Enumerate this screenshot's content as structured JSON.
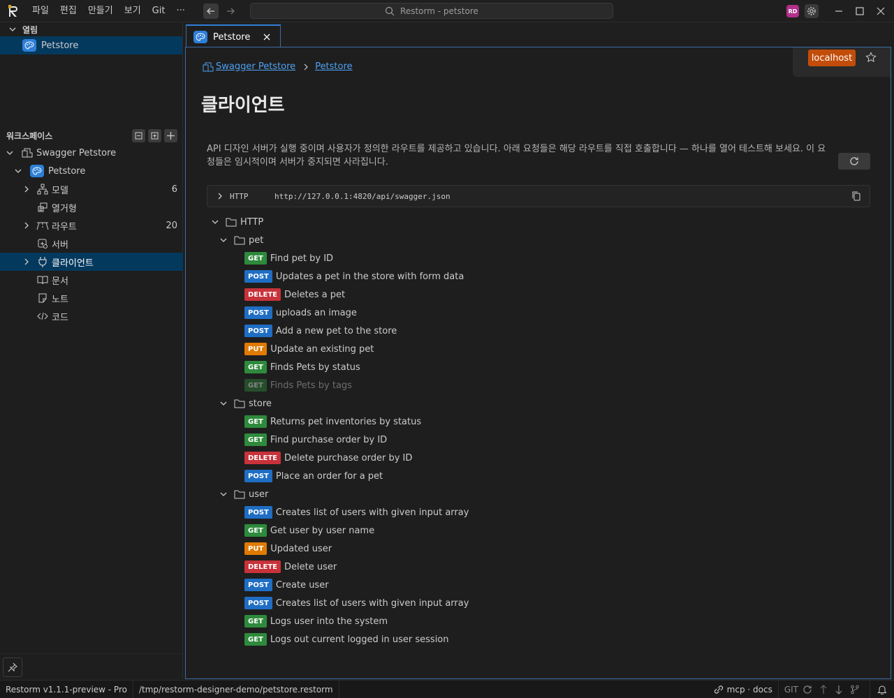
{
  "titlebar": {
    "menus": [
      "파일",
      "편집",
      "만들기",
      "보기",
      "Git",
      "···"
    ],
    "search_text": "Restorm - petstore",
    "avatar_initials": "RD"
  },
  "sidebar": {
    "open_section": "열림",
    "open_item": "Petstore",
    "workspace_section": "워크스페이스",
    "tree": {
      "root": "Swagger Petstore",
      "project": "Petstore",
      "items": [
        {
          "label": "모델",
          "count": "6"
        },
        {
          "label": "열거형",
          "count": ""
        },
        {
          "label": "라우트",
          "count": "20"
        },
        {
          "label": "서버",
          "count": ""
        },
        {
          "label": "클라이언트",
          "count": ""
        },
        {
          "label": "문서",
          "count": ""
        },
        {
          "label": "노트",
          "count": ""
        },
        {
          "label": "코드",
          "count": ""
        }
      ]
    }
  },
  "tab": {
    "label": "Petstore"
  },
  "env": {
    "label": "localhost"
  },
  "breadcrumb": {
    "root": "Swagger Petstore",
    "current": "Petstore"
  },
  "page": {
    "title": "클라이언트",
    "description": "API 디자인 서버가 실행 중이며 사용자가 정의한 라우트를 제공하고 있습니다. 아래 요청들은 해당 라우트를 직접 호출합니다 — 하나를 열어 테스트해 보세요. 이 요청들은 임시적이며 서버가 중지되면 사라집니다."
  },
  "url_bar": {
    "method": "HTTP",
    "url": "http://127.0.0.1:4820/api/swagger.json"
  },
  "requests": {
    "root": "HTTP",
    "groups": [
      {
        "name": "pet",
        "items": [
          {
            "method": "GET",
            "label": "Find pet by ID"
          },
          {
            "method": "POST",
            "label": "Updates a pet in the store with form data"
          },
          {
            "method": "DELETE",
            "label": "Deletes a pet"
          },
          {
            "method": "POST",
            "label": "uploads an image"
          },
          {
            "method": "POST",
            "label": "Add a new pet to the store"
          },
          {
            "method": "PUT",
            "label": "Update an existing pet"
          },
          {
            "method": "GET",
            "label": "Finds Pets by status"
          },
          {
            "method": "GET",
            "label": "Finds Pets by tags"
          }
        ]
      },
      {
        "name": "store",
        "items": [
          {
            "method": "GET",
            "label": "Returns pet inventories by status"
          },
          {
            "method": "GET",
            "label": "Find purchase order by ID"
          },
          {
            "method": "DELETE",
            "label": "Delete purchase order by ID"
          },
          {
            "method": "POST",
            "label": "Place an order for a pet"
          }
        ]
      },
      {
        "name": "user",
        "items": [
          {
            "method": "POST",
            "label": "Creates list of users with given input array"
          },
          {
            "method": "GET",
            "label": "Get user by user name"
          },
          {
            "method": "PUT",
            "label": "Updated user"
          },
          {
            "method": "DELETE",
            "label": "Delete user"
          },
          {
            "method": "POST",
            "label": "Create user"
          },
          {
            "method": "POST",
            "label": "Creates list of users with given input array"
          },
          {
            "method": "GET",
            "label": "Logs user into the system"
          },
          {
            "method": "GET",
            "label": "Logs out current logged in user session"
          }
        ]
      }
    ]
  },
  "statusbar": {
    "version": "Restorm v1.1.1-preview - Pro",
    "path": "/tmp/restorm-designer-demo/petstore.restorm",
    "mcp": "mcp · docs",
    "git": "GIT"
  },
  "colors": {
    "get": "#2e8a3c",
    "post": "#1f6ec4",
    "delete": "#c8323a",
    "put": "#e07a00",
    "accent": "#2e7fd8",
    "env": "#c24d0a"
  }
}
